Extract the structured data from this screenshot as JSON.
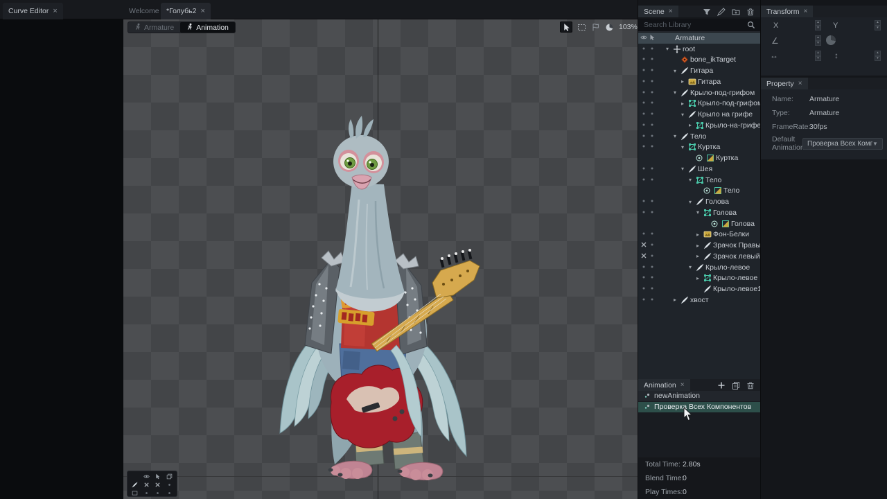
{
  "tabs": {
    "curve_editor": "Curve Editor",
    "welcome": "Welcome",
    "document": "*Голубь2"
  },
  "viewport": {
    "mode_armature": "Armature",
    "mode_animation": "Animation",
    "zoom_level": "103%",
    "toolbar_icons": [
      "pointer-icon",
      "marquee-icon",
      "flag-icon",
      "pie-icon"
    ],
    "mini_toolbar_rows": [
      [
        "none",
        "eye-icon",
        "cursor-icon",
        "layers-icon"
      ],
      [
        "bone-icon",
        "x-mark",
        "x-mark",
        "dot"
      ],
      [
        "frame-icon",
        "dot",
        "dot",
        "dot"
      ]
    ]
  },
  "scene": {
    "tab": "Scene",
    "search_placeholder": "Search Library",
    "toolbar_icons": [
      "funnel-icon",
      "pen-icon",
      "folder-add-icon",
      "trash-icon"
    ],
    "tree": [
      {
        "label": "Armature",
        "icon": "none",
        "level": 0,
        "caret": "none",
        "col1": "eye-icon",
        "col2": "cursor-icon",
        "selected": true
      },
      {
        "label": "root",
        "icon": "root-icon",
        "level": 1,
        "caret": "open",
        "col1": "dot",
        "col2": "dot"
      },
      {
        "label": "bone_ikTarget",
        "icon": "ik-icon",
        "level": 2,
        "caret": "none",
        "col1": "dot",
        "col2": "dot"
      },
      {
        "label": "Гитара",
        "icon": "bone-icon",
        "level": 2,
        "caret": "open",
        "col1": "dot",
        "col2": "dot"
      },
      {
        "label": "Гитара",
        "icon": "image-icon",
        "level": 3,
        "caret": "closed",
        "col1": "dot",
        "col2": "dot"
      },
      {
        "label": "Крыло-под-грифом",
        "icon": "bone-icon",
        "level": 2,
        "caret": "open",
        "col1": "dot",
        "col2": "dot"
      },
      {
        "label": "Крыло-под-грифом",
        "icon": "mesh-icon",
        "level": 3,
        "caret": "closed",
        "col1": "dot",
        "col2": "dot"
      },
      {
        "label": "Крыло на грифе",
        "icon": "bone-icon",
        "level": 3,
        "caret": "open",
        "col1": "dot",
        "col2": "dot"
      },
      {
        "label": "Крыло-на-грифе",
        "icon": "mesh-icon",
        "level": 4,
        "caret": "closed",
        "col1": "dot",
        "col2": "dot"
      },
      {
        "label": "Тело",
        "icon": "bone-icon",
        "level": 2,
        "caret": "open",
        "col1": "dot",
        "col2": "dot"
      },
      {
        "label": "Куртка",
        "icon": "mesh-icon",
        "level": 3,
        "caret": "open",
        "col1": "dot",
        "col2": "dot"
      },
      {
        "label": "Куртка",
        "icon": "img2-icon",
        "level": 4,
        "caret": "none",
        "col1": "none",
        "col2": "none",
        "prefix": "slot-icon"
      },
      {
        "label": "Шея",
        "icon": "bone-icon",
        "level": 3,
        "caret": "open",
        "col1": "dot",
        "col2": "dot"
      },
      {
        "label": "Тело",
        "icon": "mesh-icon",
        "level": 4,
        "caret": "open",
        "col1": "dot",
        "col2": "dot"
      },
      {
        "label": "Тело",
        "icon": "img2-icon",
        "level": 5,
        "caret": "none",
        "col1": "none",
        "col2": "none",
        "prefix": "slot-icon"
      },
      {
        "label": "Голова",
        "icon": "bone-icon",
        "level": 4,
        "caret": "open",
        "col1": "dot",
        "col2": "dot"
      },
      {
        "label": "Голова",
        "icon": "mesh-icon",
        "level": 5,
        "caret": "open",
        "col1": "dot",
        "col2": "dot"
      },
      {
        "label": "Голова",
        "icon": "img2-icon",
        "level": 6,
        "caret": "none",
        "col1": "none",
        "col2": "none",
        "prefix": "slot-icon"
      },
      {
        "label": "Фон-Белки",
        "icon": "image-icon",
        "level": 5,
        "caret": "closed",
        "col1": "dot",
        "col2": "dot"
      },
      {
        "label": "Зрачок Правый",
        "icon": "bone-icon",
        "level": 5,
        "caret": "closed",
        "col1": "x-mark",
        "col2": "dot"
      },
      {
        "label": "Зрачок левый",
        "icon": "bone-icon",
        "level": 5,
        "caret": "closed",
        "col1": "x-mark",
        "col2": "dot"
      },
      {
        "label": "Крыло-левое",
        "icon": "bone-icon",
        "level": 4,
        "caret": "open",
        "col1": "dot",
        "col2": "dot"
      },
      {
        "label": "Крыло-левое",
        "icon": "mesh-icon",
        "level": 5,
        "caret": "closed",
        "col1": "dot",
        "col2": "dot"
      },
      {
        "label": "Крыло-левое1",
        "icon": "bone-icon",
        "level": 5,
        "caret": "none",
        "col1": "dot",
        "col2": "dot"
      },
      {
        "label": "хвост",
        "icon": "bone-icon",
        "level": 2,
        "caret": "closed",
        "col1": "dot",
        "col2": "dot"
      }
    ]
  },
  "transform": {
    "tab": "Transform",
    "x_label": "X",
    "y_label": "Y"
  },
  "property": {
    "tab": "Property",
    "rows": [
      {
        "label": "Name:",
        "value": "Armature"
      },
      {
        "label": "Type:",
        "value": "Armature"
      },
      {
        "label": "FrameRate:",
        "value": "30fps"
      }
    ],
    "default_label_line1": "Default",
    "default_label_line2": "Animation:",
    "default_animation_value": "Проверка Всех Компонен"
  },
  "animation": {
    "tab": "Animation",
    "toolbar_icons": [
      "plus-icon",
      "copy-icon",
      "trash-icon"
    ],
    "items": [
      {
        "label": "newAnimation",
        "selected": false
      },
      {
        "label": "Проверка Всех Компонентов",
        "selected": true
      }
    ],
    "info": [
      {
        "label": "Total Time:",
        "value": "2.80s"
      },
      {
        "label": "Blend Time:",
        "value": "0"
      },
      {
        "label": "Play Times:",
        "value": "0"
      }
    ]
  },
  "colors": {
    "accent_teal": "#49c7a8",
    "selection_teal": "#2d4f4a",
    "ik_orange": "#e0662b",
    "image_yellow": "#caa83e"
  }
}
